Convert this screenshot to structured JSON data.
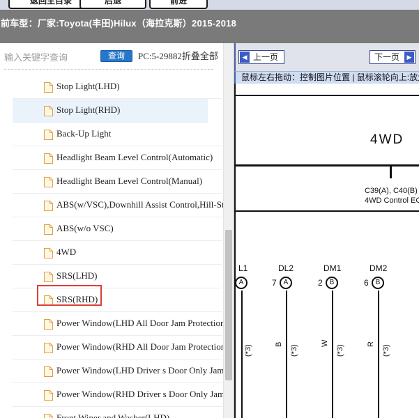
{
  "header": {
    "tabs": [
      {
        "label": "返回主目录"
      },
      {
        "label": "后退"
      },
      {
        "label": "前进"
      }
    ],
    "vehicle_label": "前车型：",
    "vehicle_value": "厂家:Toyota(丰田)Hilux（海拉克斯）2015-2018"
  },
  "search": {
    "placeholder": "输入关键字查询",
    "button_label": "查询",
    "info_text": "PC:5-29882折叠全部"
  },
  "tree": {
    "items": [
      {
        "label": "Stop Light(LHD)"
      },
      {
        "label": "Stop Light(RHD)"
      },
      {
        "label": "Back-Up Light"
      },
      {
        "label": "Headlight Beam Level Control(Automatic)"
      },
      {
        "label": "Headlight Beam Level Control(Manual)"
      },
      {
        "label": "ABS(w/VSC),Downhill Assist Control,Hill-Start Assist"
      },
      {
        "label": "ABS(w/o VSC)"
      },
      {
        "label": "4WD"
      },
      {
        "label": "SRS(LHD)"
      },
      {
        "label": "SRS(RHD)"
      },
      {
        "label": "Power Window(LHD All Door Jam Protection)"
      },
      {
        "label": "Power Window(RHD All Door Jam Protection)"
      },
      {
        "label": "Power Window(LHD Driver s Door Only Jam Protection)"
      },
      {
        "label": "Power Window(RHD Driver s Door Only Jam Protection)"
      },
      {
        "label": "Front Wiper and Washer(LHD)"
      }
    ],
    "hovered_index": 1,
    "selected_index": 7
  },
  "viewer": {
    "prev_label": "上一页",
    "next_label": "下一页",
    "hint": "鼠标左右拖动：控制图片位置 | 鼠标滚轮向上:放大"
  },
  "diagram": {
    "title": "4WD",
    "connector_code": "C39(A), C40(B)",
    "connector_name": "4WD Control ECU",
    "pins": [
      {
        "label": "L1",
        "number": "",
        "connector": "A",
        "wire": "(*3)"
      },
      {
        "label": "DL2",
        "number": "7",
        "connector": "A",
        "wire": "B"
      },
      {
        "label": "DM1",
        "number": "2",
        "connector": "B",
        "wire": "W"
      },
      {
        "label": "DM2",
        "number": "6",
        "connector": "B",
        "wire": "R"
      }
    ],
    "wire_note": "(*3)"
  },
  "colors": {
    "header_bg": "#7a7a7a",
    "search_button": "#2677c9",
    "highlight": "#d9413a",
    "hint_bar": "#cfdcf2"
  }
}
